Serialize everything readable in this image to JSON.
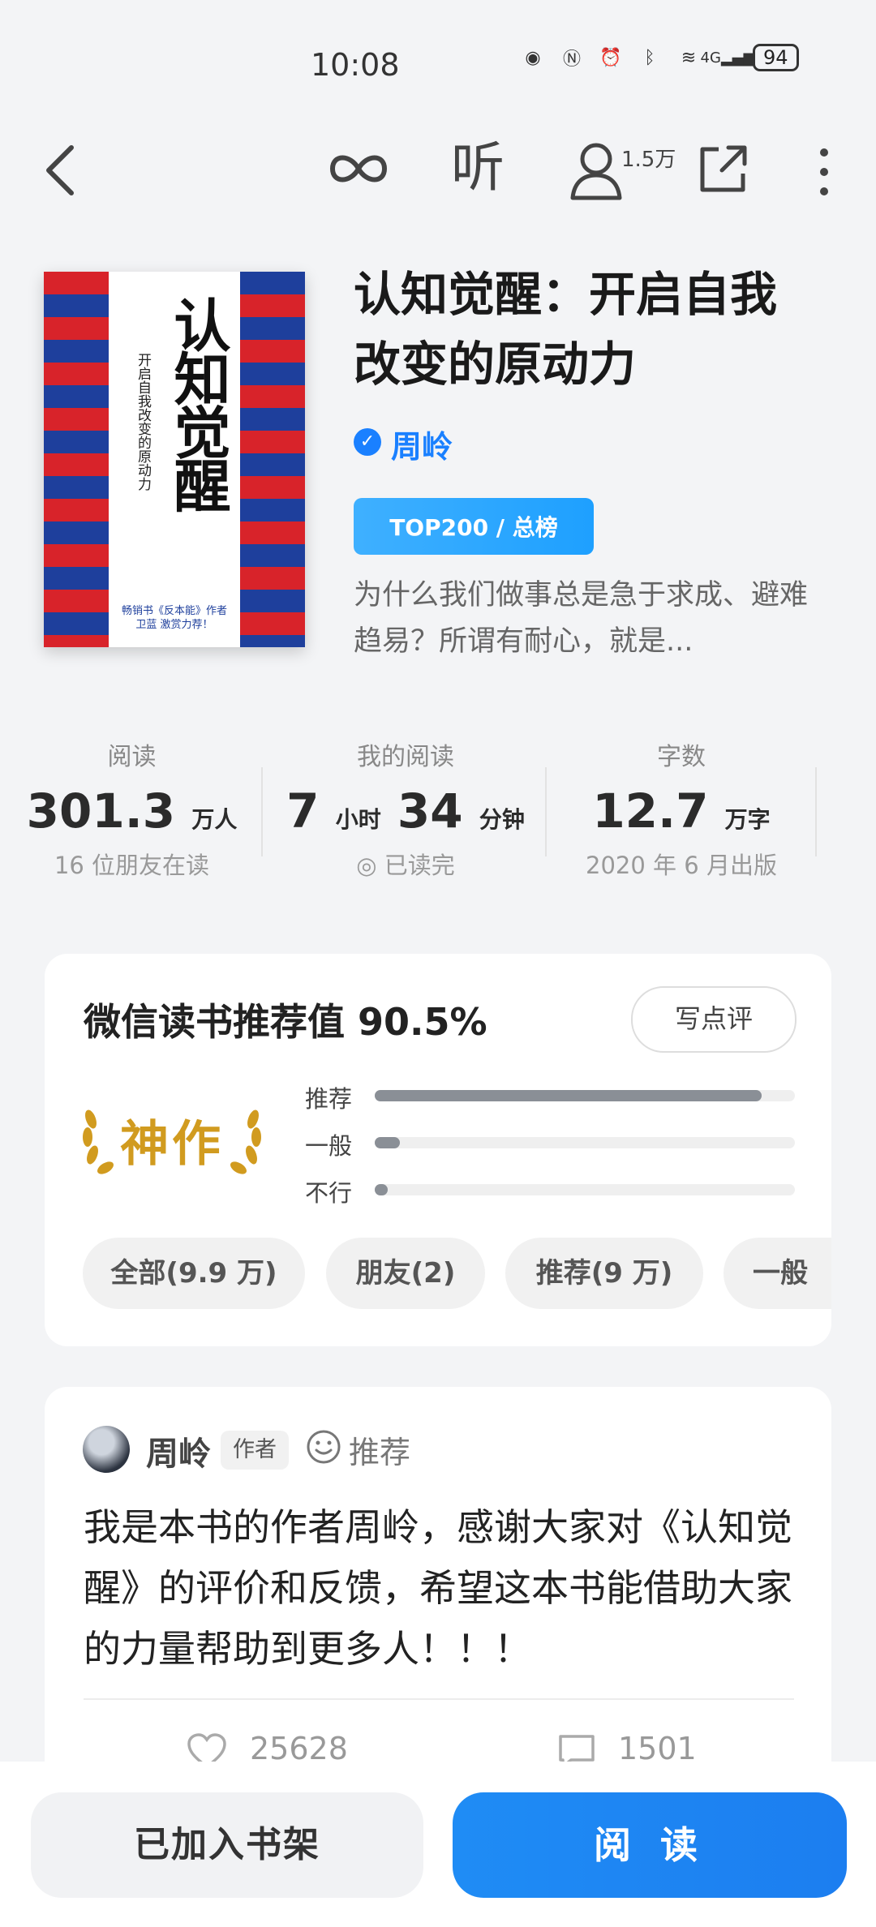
{
  "status_bar": {
    "time": "10:08",
    "battery": "94",
    "network": "4G"
  },
  "nav": {
    "listen_label": "听",
    "user_count": "1.5万"
  },
  "cover": {
    "title": "认知觉醒",
    "subtitle": "开启自我改变的原动力",
    "blurb": "畅销书《反本能》作者 卫蓝 激赏力荐！"
  },
  "book": {
    "title": "认知觉醒：开启自我改变的原动力",
    "author": "周岭",
    "badge": "TOP200 / 总榜",
    "description": "为什么我们做事总是急于求成、避难趋易？所谓有耐心，就是..."
  },
  "stats": [
    {
      "label": "阅读",
      "value": "301.3",
      "unit": "万人",
      "note": "16 位朋友在读"
    },
    {
      "label": "我的阅读",
      "value_h": "7",
      "unit_h": "小时",
      "value_m": "34",
      "unit_m": "分钟",
      "note": "已读完"
    },
    {
      "label": "字数",
      "value": "12.7",
      "unit": "万字",
      "note": "2020 年 6 月出版"
    }
  ],
  "rating": {
    "title": "微信读书推荐值 90.5%",
    "write_label": "写点评",
    "badge": "神作",
    "bars": [
      {
        "label": "推荐",
        "fraction": 0.92
      },
      {
        "label": "一般",
        "fraction": 0.06
      },
      {
        "label": "不行",
        "fraction": 0.03
      }
    ],
    "filters": [
      "全部(9.9 万)",
      "朋友(2)",
      "推荐(9 万)",
      "一般"
    ]
  },
  "review": {
    "name": "周岭",
    "tag": "作者",
    "recommend": "推荐",
    "body": "我是本书的作者周岭，感谢大家对《认知觉醒》的评价和反馈，希望这本书能借助大家的力量帮助到更多人！！！",
    "likes": "25628",
    "comments": "1501"
  },
  "bottom": {
    "shelf_label": "已加入书架",
    "read_label": "阅 读"
  },
  "colors": {
    "accent": "#1a80ff",
    "gold": "#d19b1f"
  }
}
